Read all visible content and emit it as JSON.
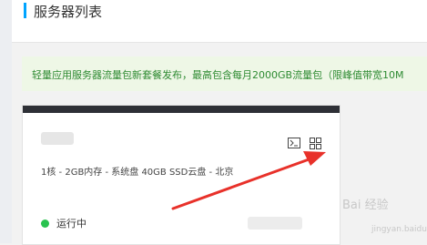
{
  "header": {
    "title": "服务器列表"
  },
  "notice": {
    "text": "轻量应用服务器流量包新套餐发布，最高包含每月2000GB流量包（限峰值带宽10M"
  },
  "server_card": {
    "specs": "1核 - 2GB内存 - 系统盘 40GB SSD云盘 - 北京",
    "status": "运行中",
    "icons": [
      "terminal-icon",
      "grid-icon"
    ],
    "status_color": "#29c24f",
    "accent_color": "#00a4ff"
  },
  "watermark": {
    "text": "Bai 经验",
    "sub": "jingyan.baidu.com"
  }
}
